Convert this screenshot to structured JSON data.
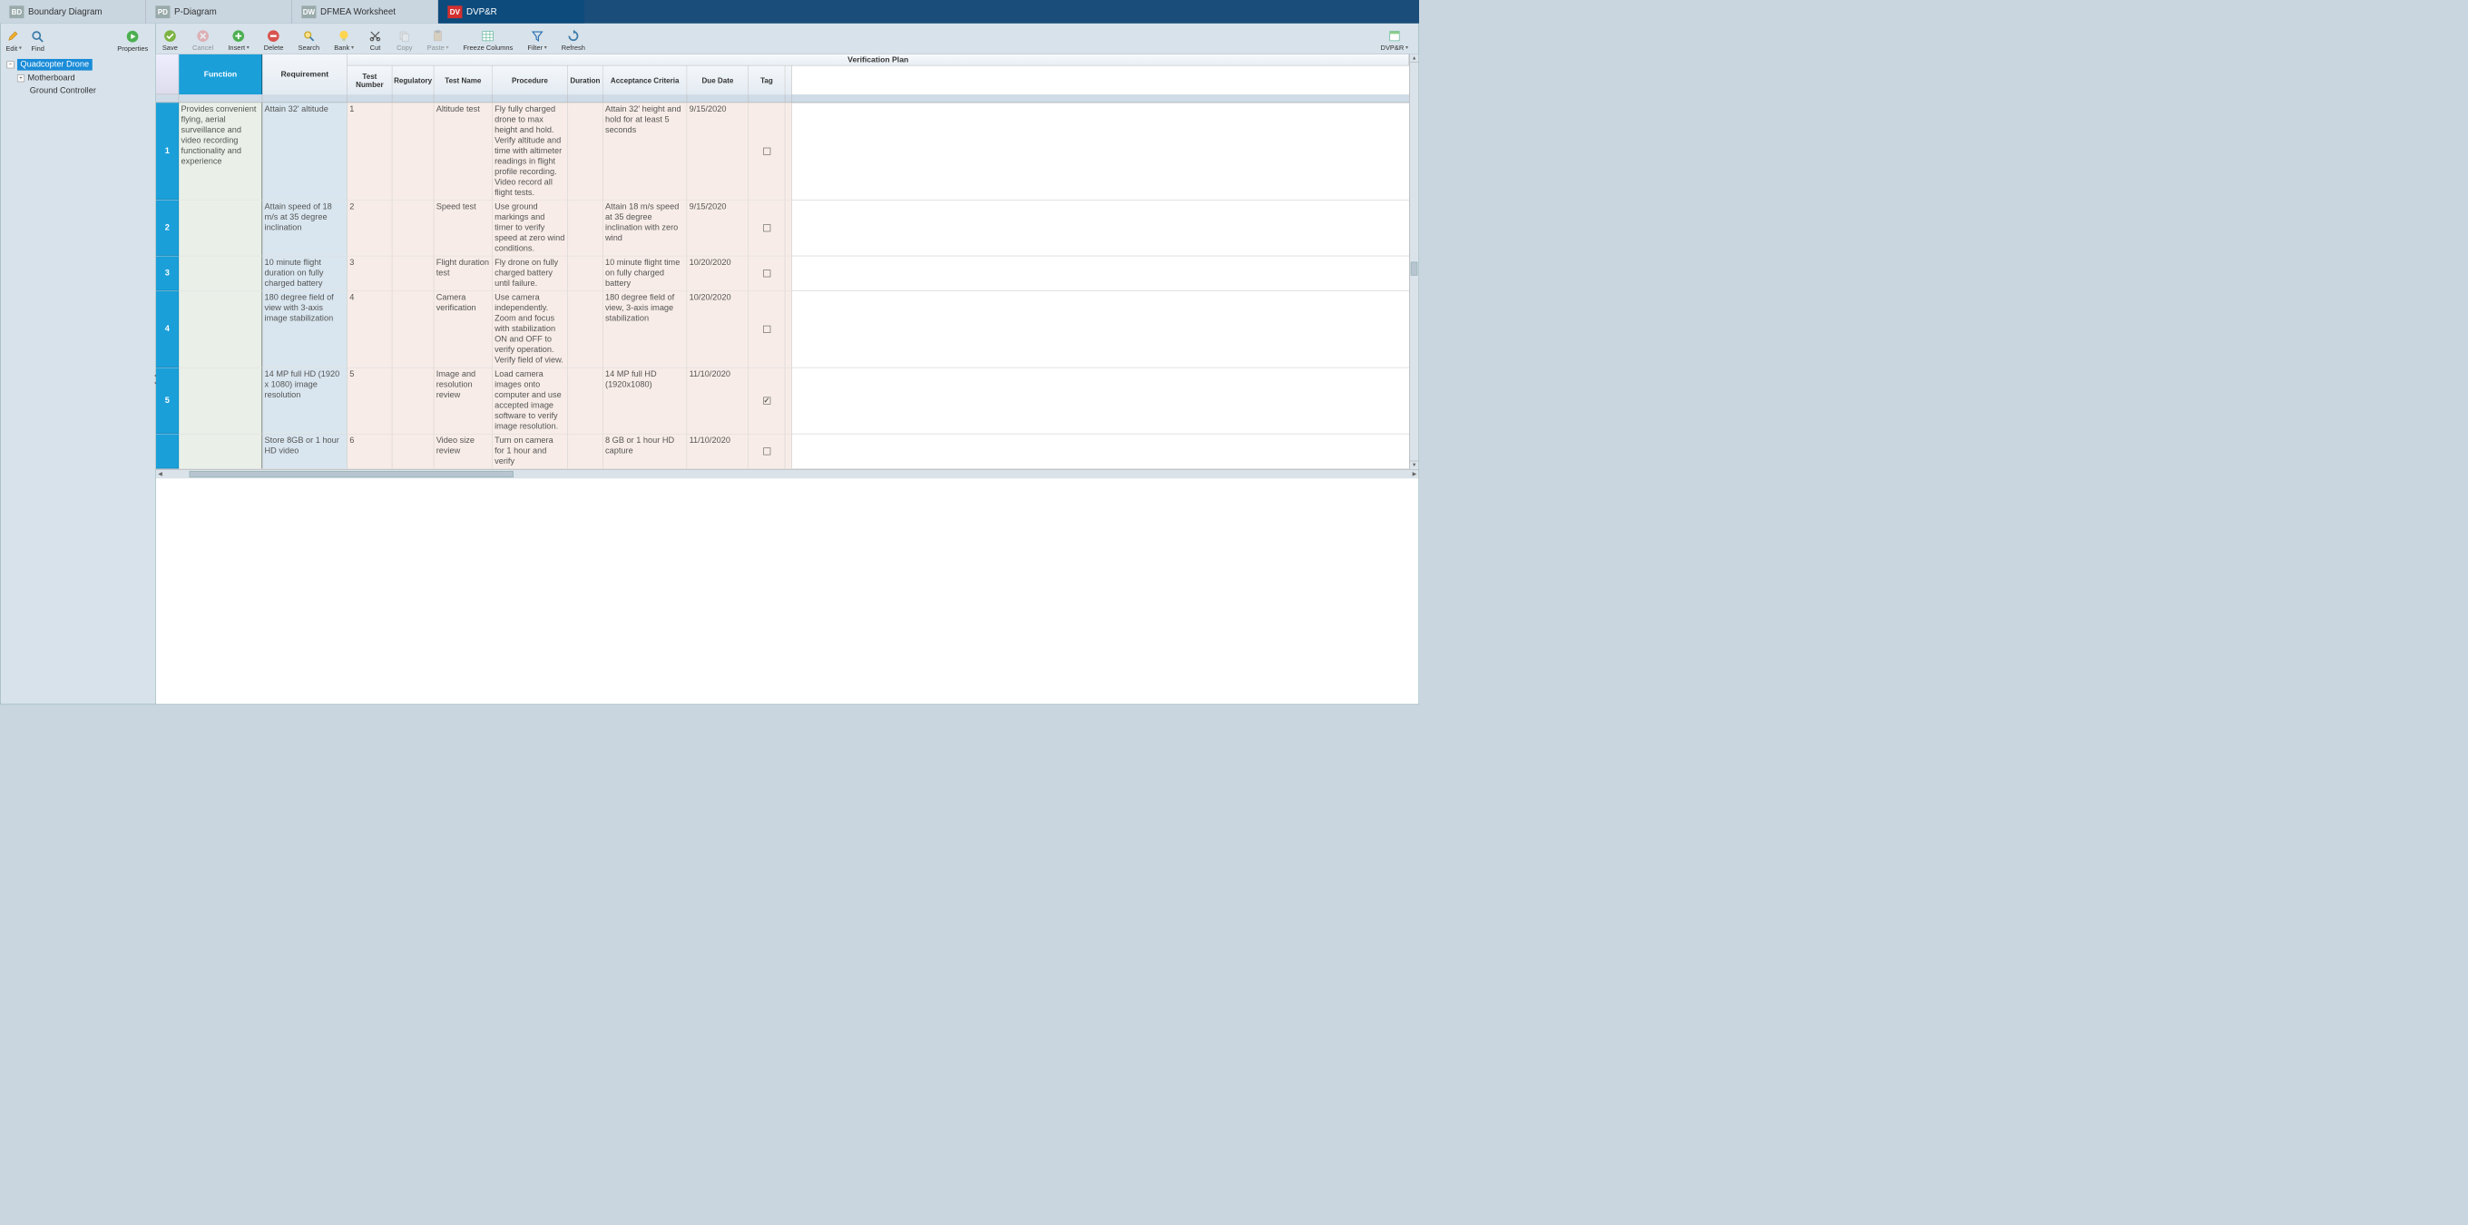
{
  "tabs": [
    {
      "code": "BD",
      "label": "Boundary Diagram"
    },
    {
      "code": "PD",
      "label": "P-Diagram"
    },
    {
      "code": "DW",
      "label": "DFMEA Worksheet"
    },
    {
      "code": "DV",
      "label": "DVP&R"
    }
  ],
  "sidebar_toolbar": {
    "edit": "Edit",
    "find": "Find",
    "properties": "Properties"
  },
  "tree": {
    "root": "Quadcopter Drone",
    "child1": "Motherboard",
    "child2": "Ground Controller"
  },
  "content_toolbar": {
    "save": "Save",
    "cancel": "Cancel",
    "insert": "Insert",
    "delete": "Delete",
    "search": "Search",
    "bank": "Bank",
    "cut": "Cut",
    "copy": "Copy",
    "paste": "Paste",
    "freeze": "Freeze Columns",
    "filter": "Filter",
    "refresh": "Refresh",
    "dvpr": "DVP&R"
  },
  "headers": {
    "function": "Function",
    "requirement": "Requirement",
    "verification_plan": "Verification Plan",
    "test_number": "Test Number",
    "regulatory": "Regulatory",
    "test_name": "Test Name",
    "procedure": "Procedure",
    "duration": "Duration",
    "acceptance": "Acceptance Criteria",
    "due_date": "Due Date",
    "tag": "Tag"
  },
  "rows": [
    {
      "n": "1",
      "function": "Provides convenient flying, aerial surveillance and video recording functionality and experience",
      "requirement": "Attain 32' altitude",
      "test_number": "1",
      "regulatory": "",
      "test_name": "Altitude test",
      "procedure": "Fly fully charged drone to max height and hold. Verify altitude and time with altimeter readings in flight profile recording. Video record all flight tests.",
      "duration": "",
      "acceptance": "Attain 32' height and hold for at least 5 seconds",
      "due_date": "9/15/2020",
      "tag": false
    },
    {
      "n": "2",
      "function": "",
      "requirement": "Attain speed of 18 m/s at 35 degree inclination",
      "test_number": "2",
      "regulatory": "",
      "test_name": "Speed test",
      "procedure": "Use ground markings and timer to verify speed at zero wind conditions.",
      "duration": "",
      "acceptance": "Attain 18 m/s speed at 35 degree inclination with zero wind",
      "due_date": "9/15/2020",
      "tag": false
    },
    {
      "n": "3",
      "function": "",
      "requirement": "10 minute flight duration on fully charged battery",
      "test_number": "3",
      "regulatory": "",
      "test_name": "Flight duration test",
      "procedure": "Fly drone on fully charged battery until failure.",
      "duration": "",
      "acceptance": "10 minute flight time on fully charged battery",
      "due_date": "10/20/2020",
      "tag": false
    },
    {
      "n": "4",
      "function": "",
      "requirement": "180 degree field of view with 3-axis image stabilization",
      "test_number": "4",
      "regulatory": "",
      "test_name": "Camera verification",
      "procedure": "Use camera independently. Zoom and focus with stabilization ON and OFF to verify operation. Verify field of view.",
      "duration": "",
      "acceptance": "180 degree field of view, 3-axis image stabilization",
      "due_date": "10/20/2020",
      "tag": false
    },
    {
      "n": "5",
      "function": "",
      "requirement": "14 MP full HD (1920 x 1080) image resolution",
      "test_number": "5",
      "regulatory": "",
      "test_name": "Image and resolution review",
      "procedure": "Load camera images onto computer and use accepted image software to verify image resolution.",
      "duration": "",
      "acceptance": "14 MP full HD (1920x1080)",
      "due_date": "11/10/2020",
      "tag": true
    },
    {
      "n": "",
      "function": "",
      "requirement": "Store 8GB or 1 hour HD video",
      "test_number": "6",
      "regulatory": "",
      "test_name": "Video size review",
      "procedure": "Turn on camera for 1 hour and verify",
      "duration": "",
      "acceptance": "8 GB or 1 hour HD capture",
      "due_date": "11/10/2020",
      "tag": false
    }
  ]
}
